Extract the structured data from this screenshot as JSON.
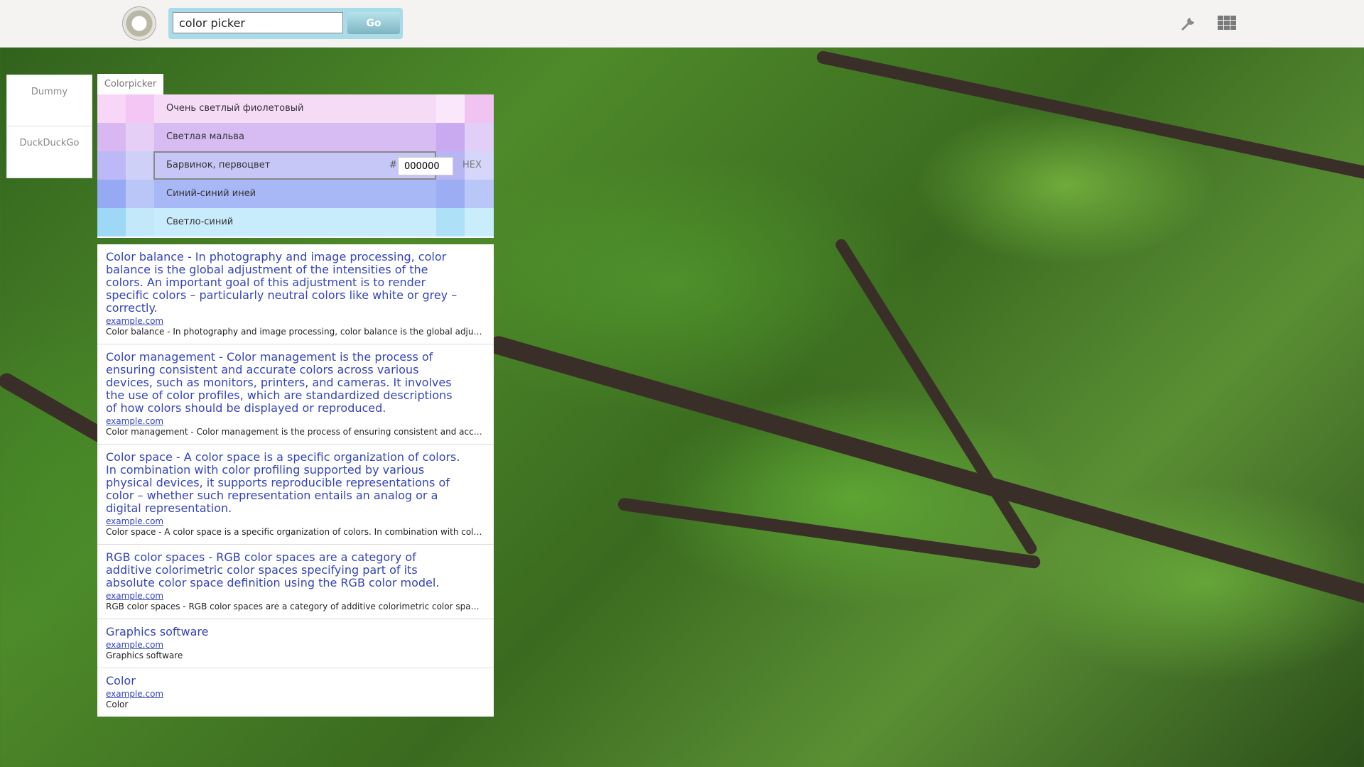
{
  "header": {
    "search_value": "color picker",
    "go_label": "Go",
    "tools_icon": "wrench-icon",
    "apps_icon": "grid-icon"
  },
  "sidebar": {
    "tabs": [
      {
        "label": "Dummy"
      },
      {
        "label": "DuckDuckGo"
      }
    ]
  },
  "colorpicker": {
    "tab_label": "Colorpicker",
    "rows": [
      {
        "label": "Очень светлый фиолетовый",
        "colors": [
          "#f7d6f7",
          "#f3c6f3",
          "#f6dbf6",
          "#fbe7fb",
          "#f0c3f0"
        ]
      },
      {
        "label": "Светлая мальва",
        "colors": [
          "#d9b8f1",
          "#e6cff7",
          "#d7bcf3",
          "#c9a9f0",
          "#e2cff7"
        ]
      },
      {
        "label": "Барвинок, первоцвет",
        "colors": [
          "#bdb8f6",
          "#cfd0f8",
          "#c6c6f7",
          "#b8b6f2",
          "#d6d6fb"
        ]
      },
      {
        "label": "Синий-синий иней",
        "colors": [
          "#96aaf3",
          "#b9c6f7",
          "#a8b8f6",
          "#9dadf3",
          "#b9c6f8"
        ]
      },
      {
        "label": "Светло-синий",
        "colors": [
          "#9ed8f6",
          "#c2e8fa",
          "#c8ecfb",
          "#aee0f8",
          "#caedfc"
        ]
      }
    ],
    "hash": "#",
    "hex_value": "000000",
    "hex_label": "HEX"
  },
  "results": [
    {
      "title": "Color balance - In photography and image processing, color balance is the global adjustment of the intensities of the colors. An important goal of this adjustment is to render specific colors – particularly neutral colors like white or grey – correctly.",
      "url": "example.com",
      "snippet": "Color balance - In photography and image processing, color balance is the global adjustment of the intensities of the colors."
    },
    {
      "title": "Color management - Color management is the process of ensuring consistent and accurate colors across various devices, such as monitors, printers, and cameras. It involves the use of color profiles, which are standardized descriptions of how colors should be displayed or reproduced.",
      "url": "example.com",
      "snippet": "Color management - Color management is the process of ensuring consistent and accurate colors across various devices."
    },
    {
      "title": "Color space - A color space is a specific organization of colors. In combination with color profiling supported by various physical devices, it supports reproducible representations of color – whether such representation entails an analog or a digital representation.",
      "url": "example.com",
      "snippet": "Color space - A color space is a specific organization of colors. In combination with color profiling supported by various physical devices."
    },
    {
      "title": "RGB color spaces - RGB color spaces are a category of additive colorimetric color spaces specifying part of its absolute color space definition using the RGB color model.",
      "url": "example.com",
      "snippet": "RGB color spaces - RGB color spaces are a category of additive colorimetric color spaces specifying part of its absolute color space definition."
    },
    {
      "title": "Graphics software",
      "url": "example.com",
      "snippet": "Graphics software"
    },
    {
      "title": "Color",
      "url": "example.com",
      "snippet": "Color"
    }
  ]
}
